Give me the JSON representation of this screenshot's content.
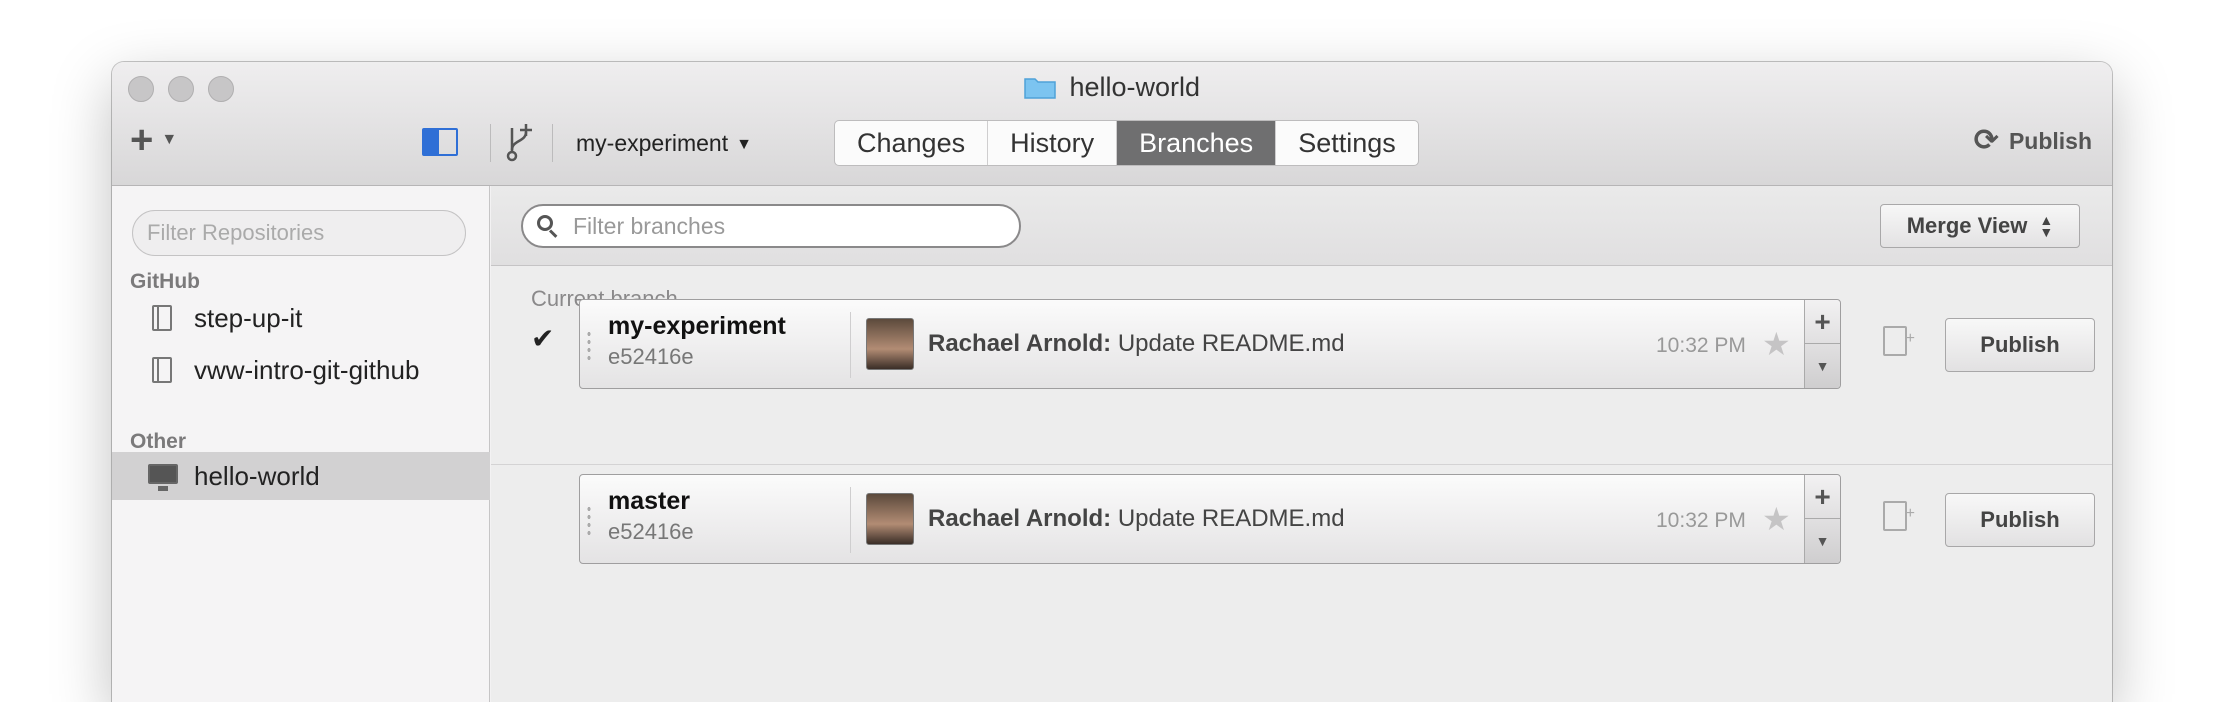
{
  "window": {
    "title": "hello-world"
  },
  "toolbar": {
    "add_icon": "plus-icon",
    "current_branch": "my-experiment",
    "tabs": [
      {
        "label": "Changes",
        "active": false
      },
      {
        "label": "History",
        "active": false
      },
      {
        "label": "Branches",
        "active": true
      },
      {
        "label": "Settings",
        "active": false
      }
    ],
    "publish_label": "Publish",
    "accent_color": "#2f6fd6"
  },
  "sidebar": {
    "filter_placeholder": "Filter Repositories",
    "sections": [
      {
        "title": "GitHub",
        "items": [
          {
            "label": "step-up-it"
          },
          {
            "label": "vww-intro-git-github"
          }
        ]
      },
      {
        "title": "Other",
        "items": [
          {
            "label": "hello-world",
            "selected": true
          }
        ]
      }
    ]
  },
  "main": {
    "filter_placeholder": "Filter branches",
    "merge_view_label": "Merge View",
    "current_branch_label": "Current branch",
    "branches": [
      {
        "name": "my-experiment",
        "sha": "e52416e",
        "author": "Rachael Arnold:",
        "message": "Update README.md",
        "time": "10:32 PM",
        "is_current": true,
        "publish_label": "Publish"
      },
      {
        "name": "master",
        "sha": "e52416e",
        "author": "Rachael Arnold:",
        "message": "Update README.md",
        "time": "10:32 PM",
        "is_current": false,
        "publish_label": "Publish"
      }
    ]
  }
}
